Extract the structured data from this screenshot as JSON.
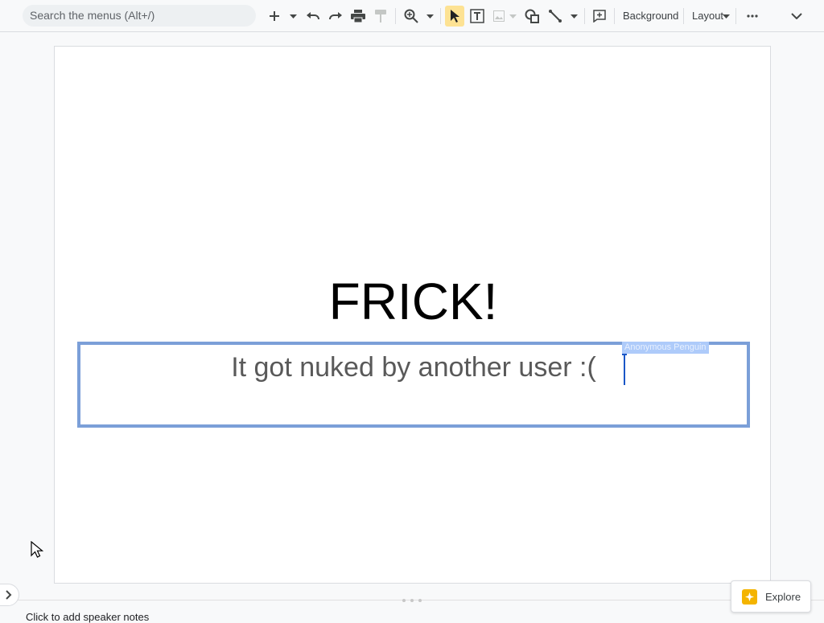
{
  "toolbar": {
    "search_placeholder": "Search the menus (Alt+/)",
    "background_label": "Background",
    "layout_label": "Layout",
    "icons": [
      "new-slide-icon",
      "undo-icon",
      "redo-icon",
      "print-icon",
      "paint-format-icon",
      "zoom-icon",
      "select-icon",
      "text-box-icon",
      "image-icon",
      "shape-icon",
      "line-icon",
      "comment-icon",
      "more-icon",
      "collapse-icon"
    ]
  },
  "slide": {
    "title": "FRICK!",
    "subtitle": "It got nuked by another user :(",
    "collaborator_name": "Anonymous Penguin",
    "collaborator_color": "#1a56c7"
  },
  "notes": {
    "placeholder": "Click to add speaker notes"
  },
  "explore": {
    "label": "Explore"
  },
  "colors": {
    "accent": "#7b9fd8",
    "select_highlight": "#fde293",
    "explore_icon": "#f4b400"
  }
}
